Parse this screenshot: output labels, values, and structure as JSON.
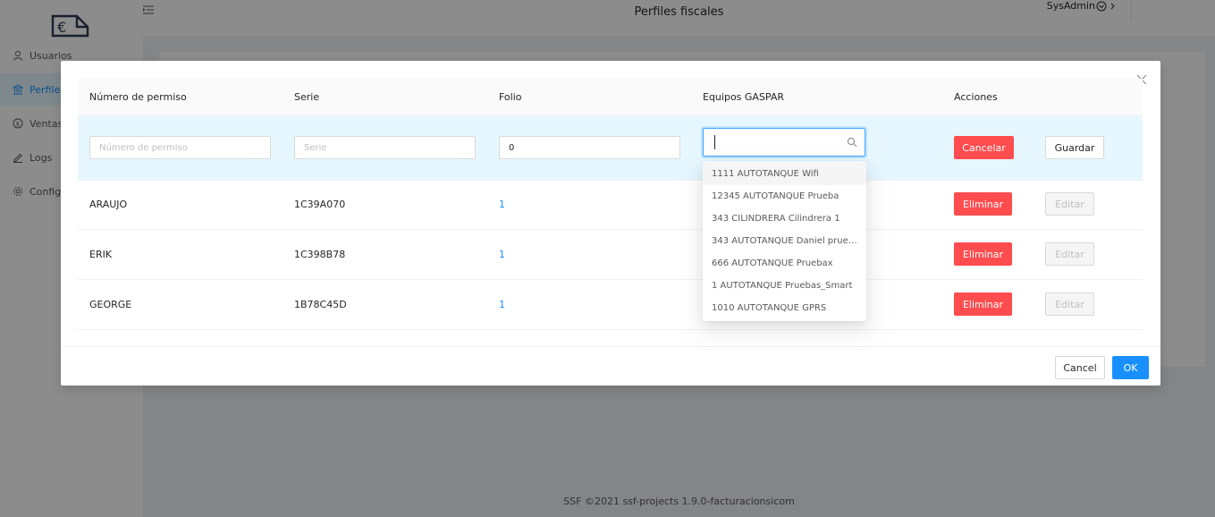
{
  "app": {
    "page_title": "Perfiles fiscales",
    "user_label": "SysAdmin",
    "footer": "SSF ©2021 ssf-projects 1.9.0-facturacionsicom"
  },
  "sidebar": {
    "items": [
      {
        "label": "Usuarios",
        "icon": "user-icon"
      },
      {
        "label": "Perfiles",
        "icon": "bank-icon",
        "active": true
      },
      {
        "label": "Ventas",
        "icon": "dollar-icon"
      },
      {
        "label": "Logs",
        "icon": "edit-icon"
      },
      {
        "label": "Configu",
        "icon": "gear-icon"
      }
    ]
  },
  "modal": {
    "columns": [
      "Número de permiso",
      "Serie",
      "Folio",
      "Equipos GASPAR",
      "Acciones"
    ],
    "edit_row": {
      "permiso_placeholder": "Número de permiso",
      "serie_placeholder": "Serie",
      "folio_value": "0",
      "equipos_value": "",
      "cancel_label": "Cancelar",
      "save_label": "Guardar"
    },
    "rows": [
      {
        "permiso": "ARAUJO",
        "serie": "1C39A070",
        "folio": "1"
      },
      {
        "permiso": "ERIK",
        "serie": "1C398B78",
        "folio": "1"
      },
      {
        "permiso": "GEORGE",
        "serie": "1B78C45D",
        "folio": "1"
      }
    ],
    "row_actions": {
      "delete_label": "Eliminar",
      "edit_label": "Editar"
    },
    "footer": {
      "cancel_label": "Cancel",
      "ok_label": "OK"
    },
    "dropdown_options": [
      "1111 AUTOTANQUE Wifi",
      "12345 AUTOTANQUE Prueba",
      "343 CILINDRERA Cilindrera 1",
      "343 AUTOTANQUE Daniel prue…",
      "666 AUTOTANQUE Pruebax",
      "1 AUTOTANQUE Pruebas_Smart",
      "1010 AUTOTANQUE GPRS"
    ]
  },
  "colors": {
    "primary": "#1890ff",
    "danger": "#ff4d4f",
    "edit_row_bg": "#e6f7ff"
  }
}
